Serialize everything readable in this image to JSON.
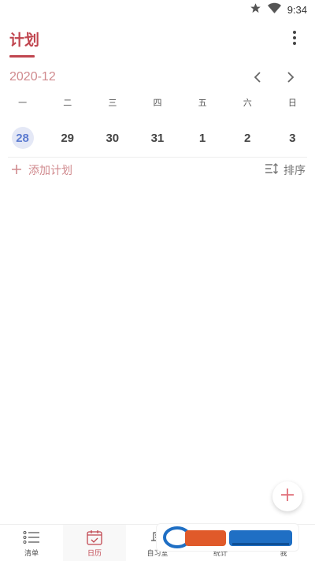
{
  "status_bar": {
    "time": "9:34"
  },
  "header": {
    "title": "计划"
  },
  "calendar": {
    "month": "2020-12",
    "weekdays": [
      "一",
      "二",
      "三",
      "四",
      "五",
      "六",
      "日"
    ],
    "dates": [
      "28",
      "29",
      "30",
      "31",
      "1",
      "2",
      "3"
    ],
    "selected_index": 0
  },
  "actions": {
    "add_plan": "添加计划",
    "sort": "排序"
  },
  "bottom_nav": {
    "items": [
      {
        "label": "清单",
        "icon": "list-icon"
      },
      {
        "label": "日历",
        "icon": "calendar-icon"
      },
      {
        "label": "自习室",
        "icon": "study-room-icon"
      },
      {
        "label": "统计",
        "icon": "chart-icon"
      },
      {
        "label": "我",
        "icon": "person-icon"
      }
    ],
    "active_index": 1
  },
  "colors": {
    "accent": "#c0454f",
    "accent_light": "#d08a8e",
    "selected_bg": "#e4e8f6",
    "selected_text": "#5c7bd0"
  }
}
